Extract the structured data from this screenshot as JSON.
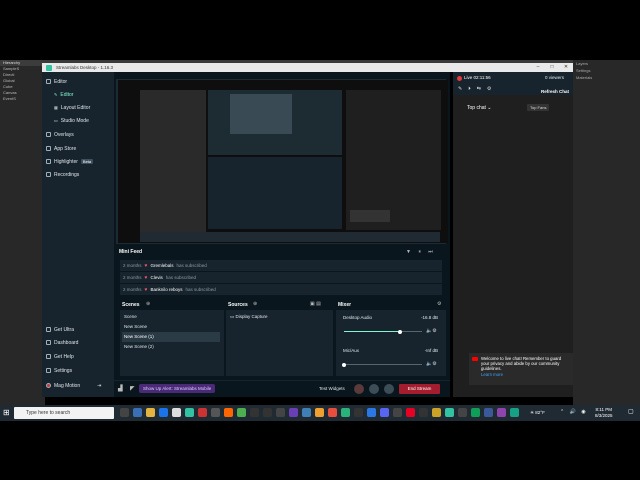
{
  "window": {
    "title": "Streamlabs Desktop - 1.16.3"
  },
  "nav": {
    "items": [
      {
        "label": "Editor"
      },
      {
        "label": "Overlays"
      },
      {
        "label": "App Store"
      },
      {
        "label": "Highlighter",
        "badge": "Beta"
      },
      {
        "label": "Recordings"
      }
    ],
    "editor_sub": [
      {
        "label": "Editor"
      },
      {
        "label": "Layout Editor"
      },
      {
        "label": "Studio Mode"
      }
    ],
    "bottom": [
      {
        "label": "Get Ultra"
      },
      {
        "label": "Dashboard"
      },
      {
        "label": "Get Help"
      },
      {
        "label": "Settings"
      },
      {
        "label": "Mag Motion"
      }
    ]
  },
  "minifeed": {
    "title": "Mini Feed",
    "rows": [
      {
        "time": "2 months",
        "name": "Gremlebals",
        "action": "has subscribed"
      },
      {
        "time": "2 months",
        "name": "Clevis",
        "action": "has subscribed"
      },
      {
        "time": "2 months",
        "name": "Banknilo reboys",
        "action": "has subscribed"
      }
    ]
  },
  "scenes": {
    "title": "Scenes",
    "items": [
      "Scene",
      "New Scene",
      "New Scene (1)",
      "New Scene (2)"
    ],
    "active_index": 2
  },
  "sources": {
    "title": "Sources",
    "items": [
      "Display Capture"
    ]
  },
  "mixer": {
    "title": "Mixer",
    "channels": [
      {
        "name": "Desktop Audio",
        "value": "-16.8 dB",
        "level": 0.72
      },
      {
        "name": "Mic/Aux",
        "value": "-Inf dB",
        "level": 0.0
      }
    ]
  },
  "footer": {
    "promo": "Show Up Alert: Streamlabs Mobile",
    "test_widgets": "Test Widgets",
    "end_stream": "End Stream"
  },
  "chat": {
    "live": "Live 02:11:56",
    "viewers": "0 viewers",
    "refresh": "Refresh Chat",
    "top_chat": "Top chat",
    "top_fans": "Top Fans",
    "welcome": "Welcome to live chat! Remember to guard your privacy and abide by our community guidelines.",
    "learn_more": "Learn more"
  },
  "taskbar": {
    "search_placeholder": "Type here to search",
    "weather": "82°F",
    "time": "8:11 PM",
    "date": "8/3/2025"
  },
  "colors": {
    "accent": "#80f5d2",
    "nav_bg": "#17242d",
    "main_bg": "#09161d",
    "end_stream": "#a31d2f"
  }
}
